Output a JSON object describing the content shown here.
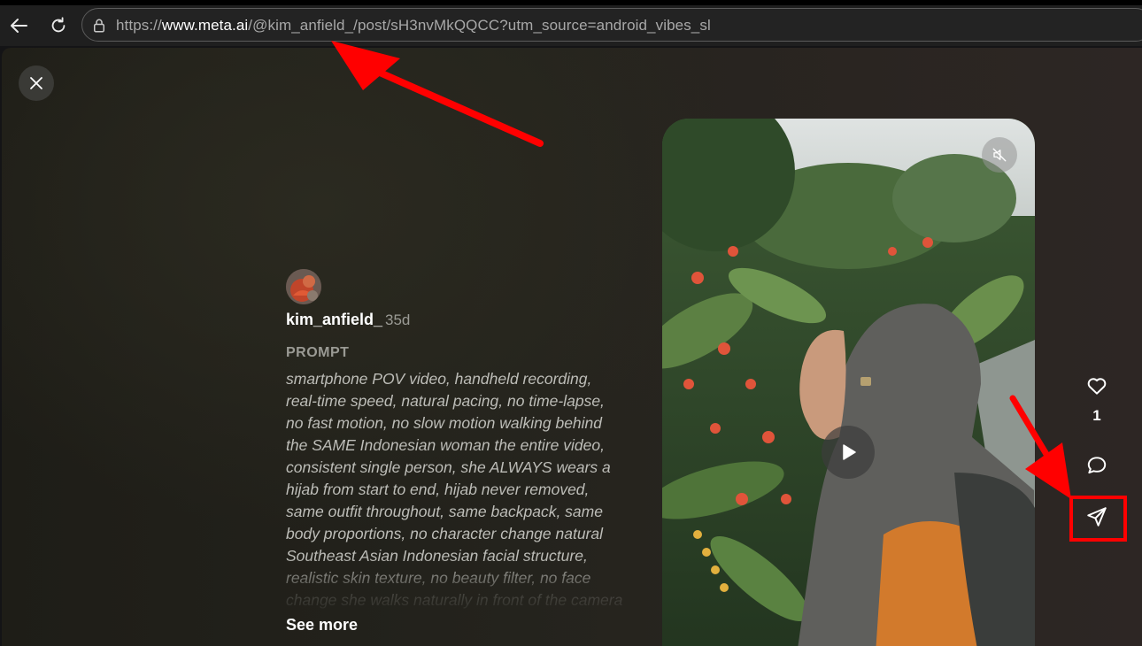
{
  "browser": {
    "url_prefix": "https://",
    "url_host": "www.meta.ai",
    "url_path": "/@kim_anfield_/post/sH3nvMkQQCC?utm_source=android_vibes_sl",
    "back_icon": "arrow-left-icon",
    "reload_icon": "reload-icon",
    "lock_icon": "site-info-icon"
  },
  "post": {
    "username": "kim_anfield_",
    "age": "35d",
    "prompt_label": "PROMPT",
    "prompt_lines": [
      "smartphone POV video, handheld recording,",
      "real-time speed, natural pacing, no time-lapse,",
      "no fast motion, no slow motion walking behind",
      "the SAME Indonesian woman the entire video,",
      "consistent single person, she ALWAYS wears a",
      "hijab from start to end, hijab never removed,",
      "same outfit throughout, same backpack, same",
      "body proportions, no character change natural",
      "Southeast Asian Indonesian facial structure,",
      "realistic skin texture, no beauty filter, no face",
      "change she walks naturally in front of the camera"
    ],
    "see_more": "See more",
    "like_count": "1"
  },
  "icons": {
    "close": "close-icon",
    "mute": "muted-speaker-icon",
    "play": "play-icon",
    "like": "heart-icon",
    "comment": "comment-bubble-icon",
    "share": "send-icon"
  },
  "colors": {
    "annotation": "#ff0000",
    "page_bg": "#24231d",
    "text_primary": "#ffffff",
    "text_secondary": "#bdbdb8"
  }
}
